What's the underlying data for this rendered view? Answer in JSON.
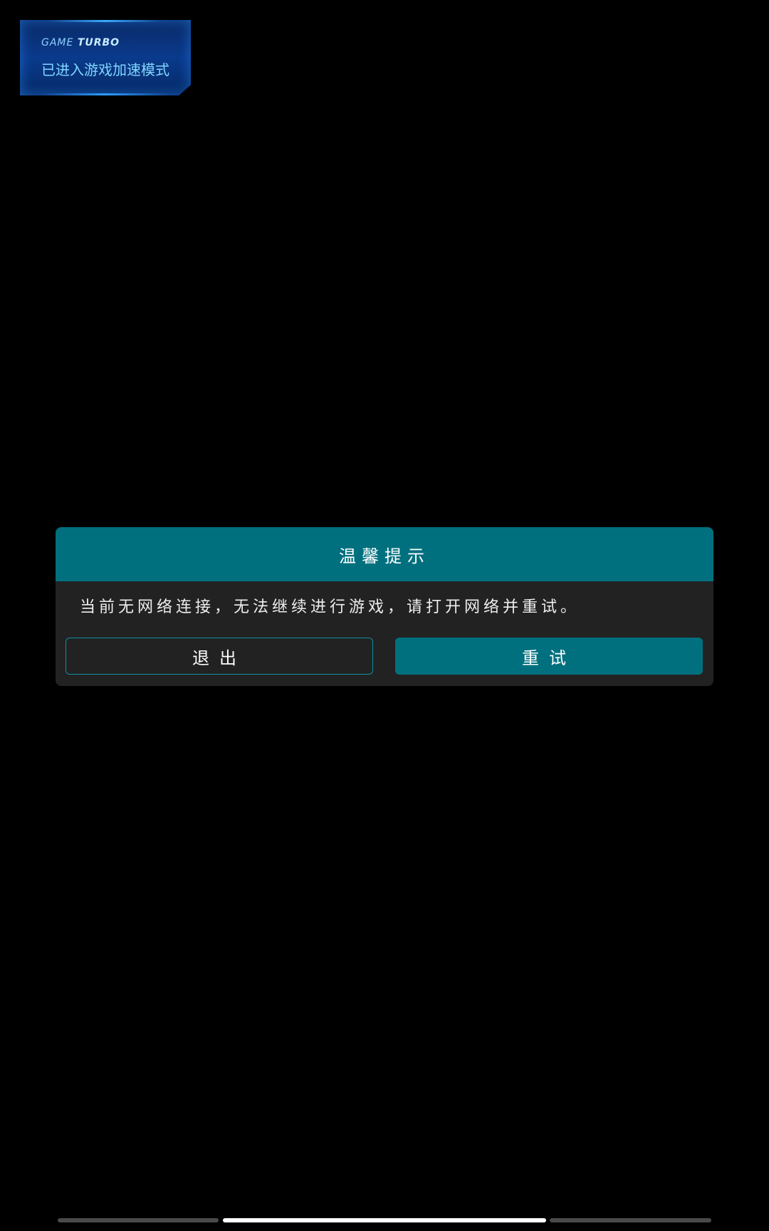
{
  "turbo_toast": {
    "brand_light": "GAME",
    "brand_bold": "TURBO",
    "message": "已进入游戏加速模式"
  },
  "dialog": {
    "title": "温馨提示",
    "message": "当前无网络连接，无法继续进行游戏，请打开网络并重试。",
    "exit_label": "退出",
    "retry_label": "重试"
  },
  "colors": {
    "accent": "#00707f",
    "dialog_bg": "#222222",
    "toast_text": "#7fd6ff"
  }
}
